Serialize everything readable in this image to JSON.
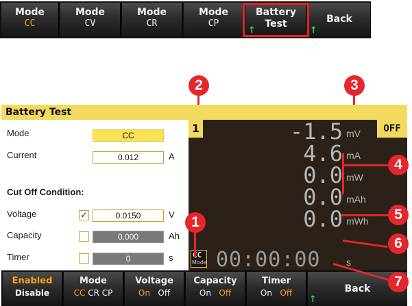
{
  "top_softkeys": [
    {
      "label": "Mode",
      "value": "CC"
    },
    {
      "label": "Mode",
      "value": "CV"
    },
    {
      "label": "Mode",
      "value": "CR"
    },
    {
      "label": "Mode",
      "value": "CP"
    },
    {
      "label": "Battery",
      "value": "Test"
    },
    {
      "label": "Back"
    }
  ],
  "screen": {
    "title": "Battery Test",
    "form": {
      "mode_label": "Mode",
      "mode_value": "CC",
      "current_label": "Current",
      "current_value": "0.012",
      "current_unit": "A",
      "cutoff_heading": "Cut Off Condition:",
      "voltage_label": "Voltage",
      "voltage_checked": true,
      "voltage_check_glyph": "✓",
      "voltage_value": "0.0150",
      "voltage_unit": "V",
      "capacity_label": "Capacity",
      "capacity_checked": false,
      "capacity_value": "0.000",
      "capacity_unit": "Ah",
      "timer_label": "Timer",
      "timer_checked": false,
      "timer_value": "0",
      "timer_unit": "s"
    },
    "readout": {
      "channel": "1",
      "output_state": "OFF",
      "voltage": "-1.5",
      "voltage_unit": "mV",
      "current": "4.6",
      "current_unit": "mA",
      "power": "0.0",
      "power_unit": "mW",
      "capacity": "0.0",
      "capacity_unit": "mAh",
      "energy": "0.0",
      "energy_unit": "mWh",
      "mode_indicator": "CC",
      "mode_caption": "Mode",
      "elapsed": "00:00:00",
      "elapsed_unit": "s"
    },
    "bottom_softkeys": {
      "enable": {
        "top": "Enabled",
        "bottom": "Disable"
      },
      "mode": {
        "top": "Mode",
        "opt1": "CC",
        "opt2": "CR",
        "opt3": "CP"
      },
      "voltage": {
        "top": "Voltage",
        "on": "On",
        "off": "Off"
      },
      "capacity": {
        "top": "Capacity",
        "on": "On",
        "off": "Off"
      },
      "timer": {
        "top": "Timer",
        "on": "On",
        "off": "Off"
      },
      "back": "Back"
    }
  },
  "callouts": [
    "1",
    "2",
    "3",
    "4",
    "5",
    "6",
    "7"
  ],
  "colors": {
    "accent_yellow": "#f2da5e",
    "softkey_orange": "#f5a21b",
    "callout_red": "#e5262b",
    "arrow_green": "#3fd33f"
  }
}
